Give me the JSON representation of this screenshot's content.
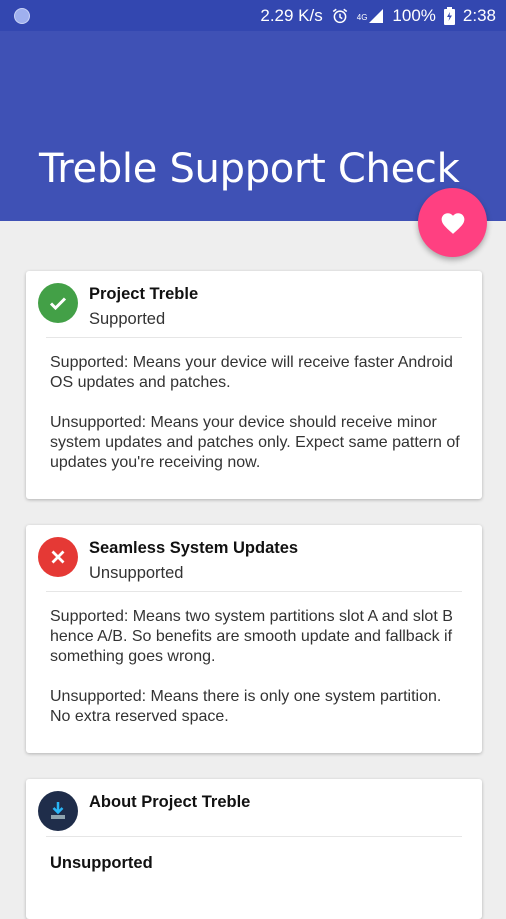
{
  "status_bar": {
    "speed": "2.29 K/s",
    "network": "4G",
    "battery": "100%",
    "time": "2:38"
  },
  "app": {
    "title": "Treble Support Check"
  },
  "fab": {
    "icon": "heart-icon"
  },
  "cards": [
    {
      "title": "Project Treble",
      "status": "Supported",
      "status_icon": "check-circle-icon",
      "status_color": "#43a047",
      "body_supported": "Supported: Means your device will receive faster Android OS updates and patches.",
      "body_unsupported": "Unsupported: Means your device should receive minor system updates and patches only. Expect same pattern of updates you're receiving now."
    },
    {
      "title": "Seamless System Updates",
      "status": "Unsupported",
      "status_icon": "cancel-circle-icon",
      "status_color": "#e53935",
      "body_supported": "Supported: Means two system partitions slot A and slot B hence A/B. So benefits are smooth update and fallback if something goes wrong.",
      "body_unsupported": "Unsupported: Means there is only one system partition. No extra reserved space."
    },
    {
      "title": "About Project Treble",
      "status_icon": "download-icon",
      "status_color": "#1f2d4a",
      "value": "Unsupported"
    }
  ],
  "colors": {
    "primary": "#3f51b5",
    "primary_dark": "#3347b0",
    "accent": "#ff4081",
    "background": "#eeeeee"
  }
}
